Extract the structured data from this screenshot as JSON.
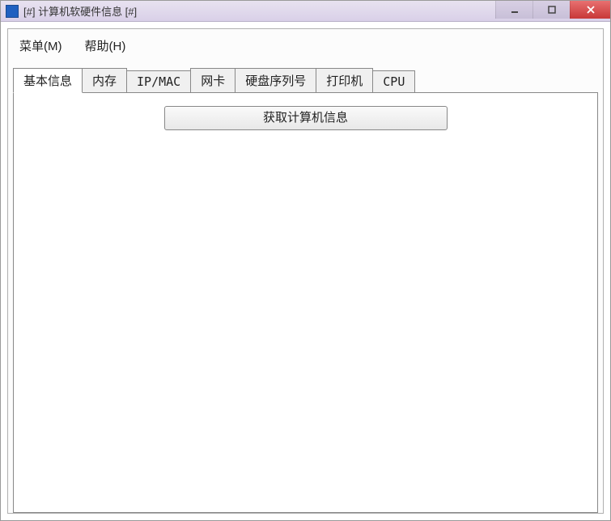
{
  "window": {
    "title": "[#] 计算机软硬件信息 [#]"
  },
  "menu": {
    "items": [
      {
        "label": "菜单(M)"
      },
      {
        "label": "帮助(H)"
      }
    ]
  },
  "tabs": {
    "items": [
      {
        "label": "基本信息",
        "active": true
      },
      {
        "label": "内存",
        "active": false
      },
      {
        "label": "IP/MAC",
        "active": false
      },
      {
        "label": "网卡",
        "active": false
      },
      {
        "label": "硬盘序列号",
        "active": false
      },
      {
        "label": "打印机",
        "active": false
      },
      {
        "label": "CPU",
        "active": false
      }
    ]
  },
  "actions": {
    "get_info_label": "获取计算机信息"
  }
}
